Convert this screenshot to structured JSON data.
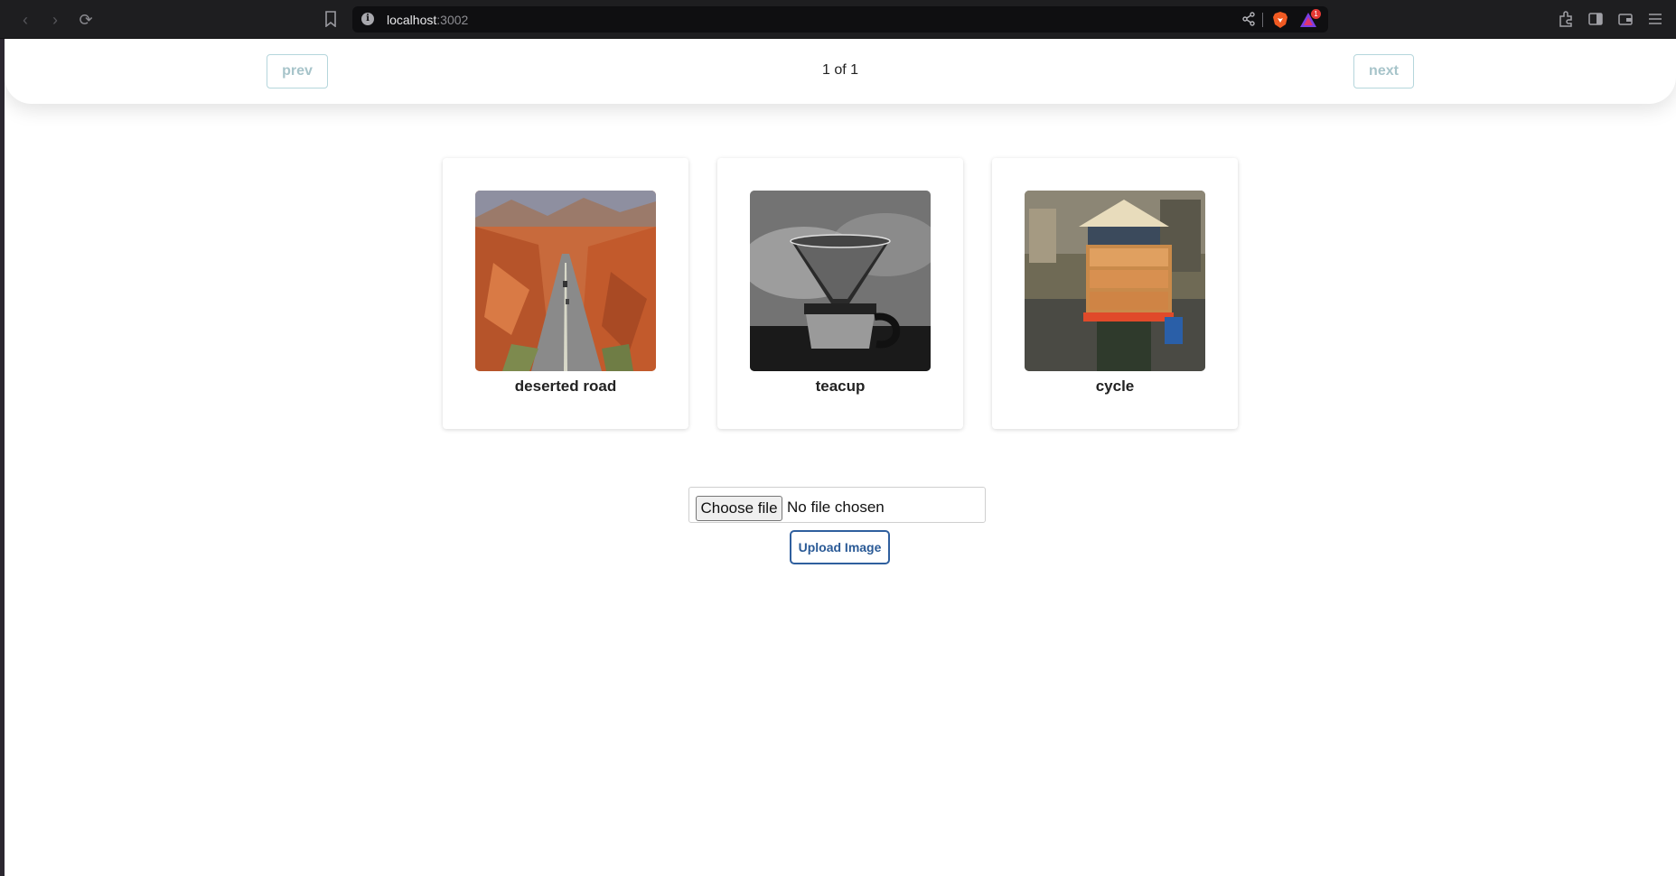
{
  "browser": {
    "url_host": "localhost",
    "url_port": ":3002",
    "rewards_badge": "1"
  },
  "pagination": {
    "prev_label": "prev",
    "page_label": "1 of 1",
    "next_label": "next"
  },
  "images": [
    {
      "title": "deserted road"
    },
    {
      "title": "teacup"
    },
    {
      "title": "cycle"
    }
  ],
  "upload": {
    "choose_label": "Choose file",
    "status": "No file chosen",
    "upload_label": "Upload Image"
  },
  "colors": {
    "accent": "#2f5f9e",
    "pager_border": "#b5d6dc"
  }
}
